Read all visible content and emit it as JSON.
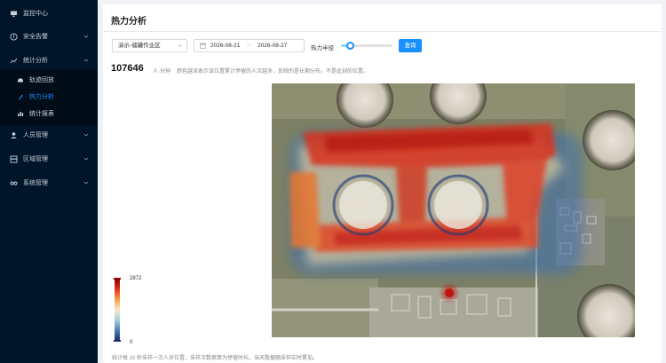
{
  "sidebar": {
    "items": [
      {
        "label": "监控中心",
        "icon": "monitor-icon"
      },
      {
        "label": "安全告警",
        "icon": "alert-icon"
      },
      {
        "label": "统计分析",
        "icon": "chart-icon",
        "expanded": true
      },
      {
        "label": "人员管理",
        "icon": "user-icon"
      },
      {
        "label": "区域管理",
        "icon": "region-icon"
      },
      {
        "label": "系统管理",
        "icon": "settings-icon"
      }
    ],
    "sub_items": [
      {
        "label": "轨迹回放",
        "icon": "car-icon"
      },
      {
        "label": "热力分析",
        "icon": "flame-icon",
        "active": true
      },
      {
        "label": "统计报表",
        "icon": "report-icon"
      }
    ]
  },
  "page": {
    "title": "热力分析"
  },
  "filters": {
    "area_select": "演示-储罐作业区",
    "date_start": "2026-08-21",
    "date_sep": "~",
    "date_end": "2026-08-27",
    "radius_label": "热力半径",
    "radius_value": 0.12,
    "query_label": "查询"
  },
  "stats": {
    "total": "107646",
    "unit": "人·分钟",
    "description": "颜色越深表示该位置累计停留的人次越多，反映的是长期分布，不是此刻的位置。"
  },
  "legend": {
    "max": "2872",
    "min": "0"
  },
  "footnote": "统计每 10 秒采样一次人员位置，采样次数换算为停留时长。当天数据随采样实时累加。",
  "colors": {
    "sidebar_bg": "#001529",
    "accent": "#1890ff"
  }
}
